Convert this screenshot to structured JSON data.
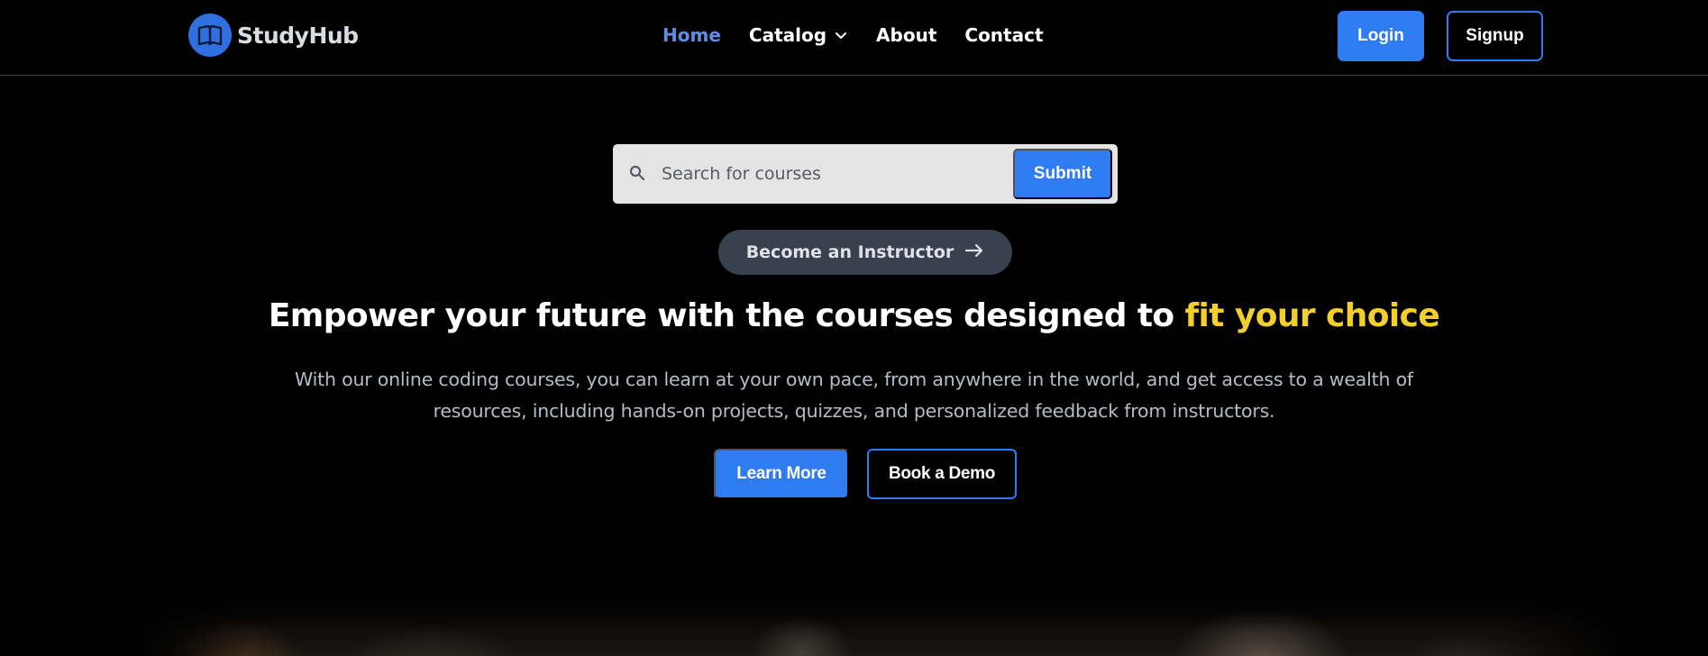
{
  "brand": {
    "name": "StudyHub",
    "logo_icon": "open-book-icon",
    "accent_color": "#2f7cf0"
  },
  "nav": {
    "items": [
      {
        "label": "Home",
        "active": true
      },
      {
        "label": "Catalog",
        "has_dropdown": true
      },
      {
        "label": "About"
      },
      {
        "label": "Contact"
      }
    ]
  },
  "auth": {
    "login_label": "Login",
    "signup_label": "Signup"
  },
  "search": {
    "placeholder": "Search for courses",
    "value": "",
    "submit_label": "Submit"
  },
  "instructor_cta": {
    "label": "Become an Instructor",
    "icon": "arrow-right-icon"
  },
  "hero": {
    "title_main": "Empower your future with the courses designed to ",
    "title_highlight": "fit your choice",
    "highlight_color": "#f2cf2a",
    "subtitle": "With our online coding courses, you can learn at your own pace, from anywhere in the world, and get access to a wealth of resources, including hands-on projects, quizzes, and personalized feedback from instructors.",
    "primary_button": "Learn More",
    "secondary_button": "Book a Demo"
  }
}
